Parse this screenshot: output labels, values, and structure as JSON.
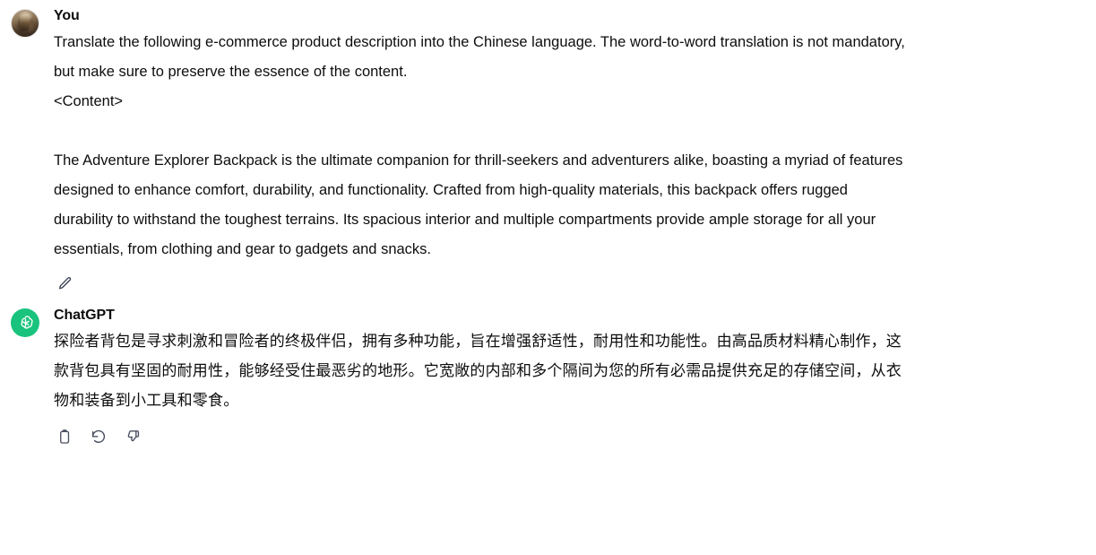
{
  "conversation": {
    "messages": [
      {
        "role": "user",
        "author": "You",
        "avatar_icon": "user-photo-avatar",
        "paragraphs": [
          "Translate the following e-commerce product description into the Chinese language. The word-to-word translation is not mandatory, but make sure to preserve the essence of the content.",
          "<Content>",
          "",
          "The Adventure Explorer Backpack is the ultimate companion for thrill-seekers and adventurers alike, boasting a myriad of features designed to enhance comfort, durability, and functionality. Crafted from high-quality materials, this backpack offers rugged durability to withstand the toughest terrains. Its spacious interior and multiple compartments provide ample storage for all your essentials, from clothing and gear to gadgets and snacks."
        ],
        "actions": [
          {
            "name": "edit-message-button",
            "icon": "pencil-icon",
            "label": "Edit"
          }
        ]
      },
      {
        "role": "assistant",
        "author": "ChatGPT",
        "avatar_icon": "openai-logo-icon",
        "avatar_color": "#19c37d",
        "paragraphs": [
          "探险者背包是寻求刺激和冒险者的终极伴侣，拥有多种功能，旨在增强舒适性，耐用性和功能性。由高品质材料精心制作，这款背包具有坚固的耐用性，能够经受住最恶劣的地形。它宽敞的内部和多个隔间为您的所有必需品提供充足的存储空间，从衣物和装备到小工具和零食。"
        ],
        "actions": [
          {
            "name": "copy-button",
            "icon": "clipboard-icon",
            "label": "Copy"
          },
          {
            "name": "regenerate-button",
            "icon": "refresh-ccw-icon",
            "label": "Regenerate"
          },
          {
            "name": "thumbs-down-button",
            "icon": "thumbs-down-icon",
            "label": "Bad response"
          }
        ]
      }
    ]
  },
  "theme": {
    "background": "#ffffff",
    "text_color": "#0d0d0d",
    "icon_color": "#4a4f60",
    "assistant_accent": "#19c37d"
  }
}
